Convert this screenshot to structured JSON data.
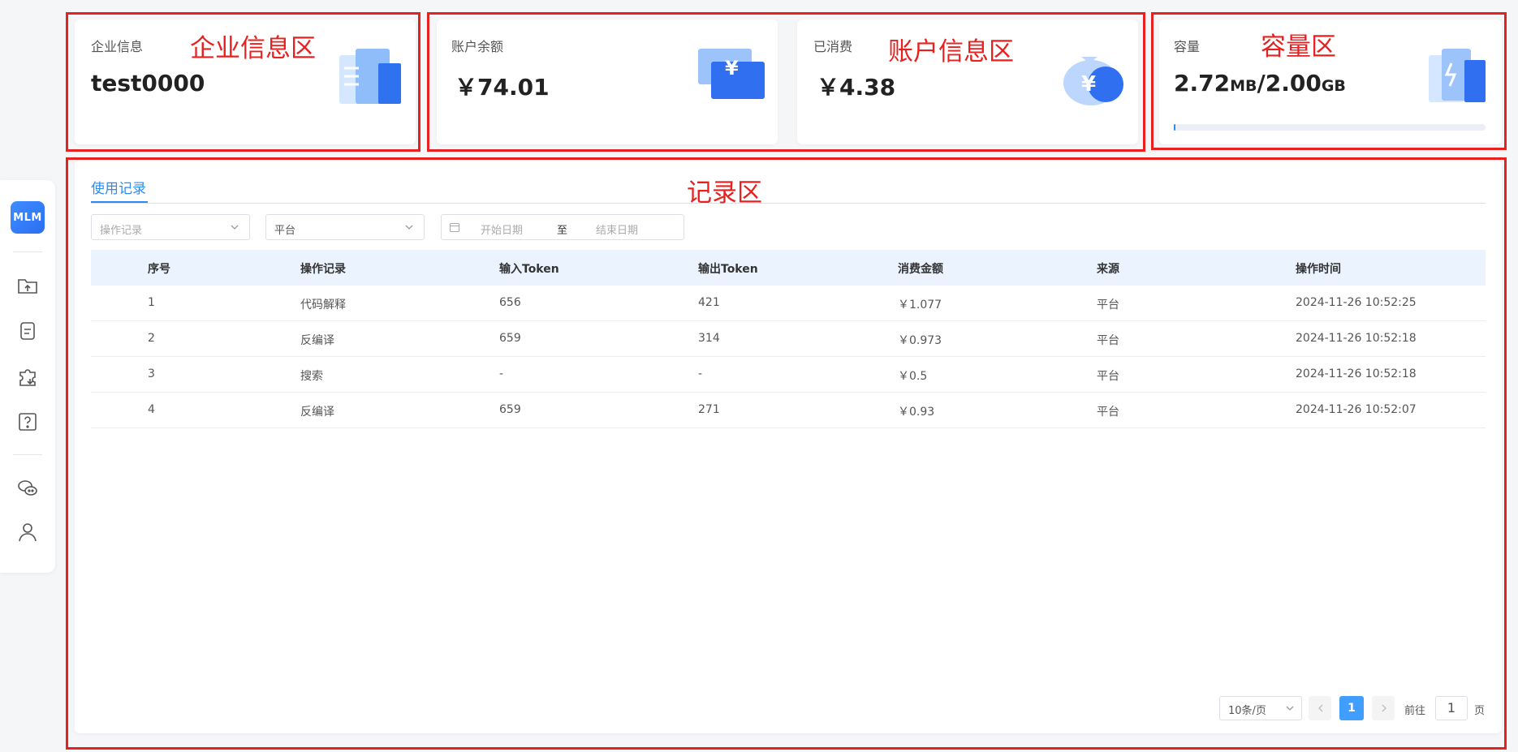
{
  "sidebar": {
    "logo_text": "MLM",
    "icons": [
      "folder-upload-icon",
      "document-icon",
      "plugin-icon",
      "help-icon",
      "wechat-icon",
      "user-icon"
    ]
  },
  "cards": {
    "enterprise": {
      "label": "企业信息",
      "value": "test0000"
    },
    "balance": {
      "label": "账户余额",
      "value": "￥74.01"
    },
    "consumed": {
      "label": "已消费",
      "value": "￥4.38"
    },
    "capacity": {
      "label": "容量",
      "used": "2.72",
      "used_unit": "MB",
      "sep": "/",
      "total": "2.00",
      "total_unit": "GB",
      "usage_fraction": 0.0013
    }
  },
  "annotations": {
    "enterprise_zone": "企业信息区",
    "account_zone": "账户信息区",
    "capacity_zone": "容量区",
    "record_zone": "记录区"
  },
  "records": {
    "tab_label": "使用记录",
    "filters": {
      "operation_placeholder": "操作记录",
      "platform_value": "平台",
      "date_start_placeholder": "开始日期",
      "date_sep": "至",
      "date_end_placeholder": "结束日期"
    },
    "columns": [
      "序号",
      "操作记录",
      "输入Token",
      "输出Token",
      "消费金额",
      "来源",
      "操作时间"
    ],
    "rows": [
      [
        "1",
        "代码解释",
        "656",
        "421",
        "￥1.077",
        "平台",
        "2024-11-26 10:52:25"
      ],
      [
        "2",
        "反编译",
        "659",
        "314",
        "￥0.973",
        "平台",
        "2024-11-26 10:52:18"
      ],
      [
        "3",
        "搜索",
        "-",
        "-",
        "￥0.5",
        "平台",
        "2024-11-26 10:52:18"
      ],
      [
        "4",
        "反编译",
        "659",
        "271",
        "￥0.93",
        "平台",
        "2024-11-26 10:52:07"
      ]
    ],
    "pagination": {
      "page_size": "10条/页",
      "current_page": "1",
      "goto_label": "前往",
      "goto_value": "1",
      "page_suffix": "页"
    }
  },
  "colors": {
    "accent": "#2d8cf0",
    "annotation_red": "#e82020"
  }
}
